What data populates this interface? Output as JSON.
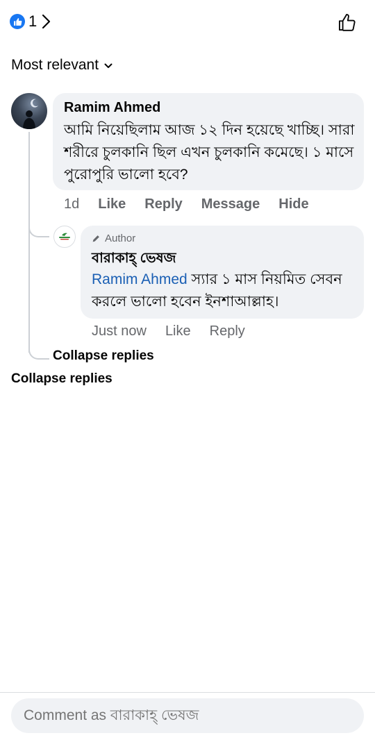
{
  "reactions": {
    "like_count": "1"
  },
  "sort": {
    "label": "Most relevant"
  },
  "comment": {
    "author": "Ramim Ahmed",
    "text": "আমি নিয়েছিলাম আজ ১২ দিন হয়েছে খাচ্ছি। সারা শরীরে চুলকানি ছিল এখন চুলকানি কমেছে। ১ মাসে পুরোপুরি ভালো হবে?",
    "time": "1d",
    "actions": {
      "like": "Like",
      "reply": "Reply",
      "message": "Message",
      "hide": "Hide"
    }
  },
  "reply": {
    "author_badge": "Author",
    "author": "বারাকাহ্ ভেষজ",
    "mention": "Ramim Ahmed",
    "text": " স্যার ১ মাস নিয়মিত সেবন করলে ভালো হবেন ইনশাআল্লাহ।",
    "time": "Just now",
    "actions": {
      "like": "Like",
      "reply": "Reply"
    }
  },
  "collapse_inner": "Collapse replies",
  "collapse_outer": "Collapse replies",
  "composer": {
    "placeholder": "Comment as বারাকাহ্ ভেষজ"
  },
  "colors": {
    "accent": "#1877f2",
    "mention": "#1a5fb4",
    "bubble": "#f0f2f5",
    "muted": "#65676b"
  }
}
